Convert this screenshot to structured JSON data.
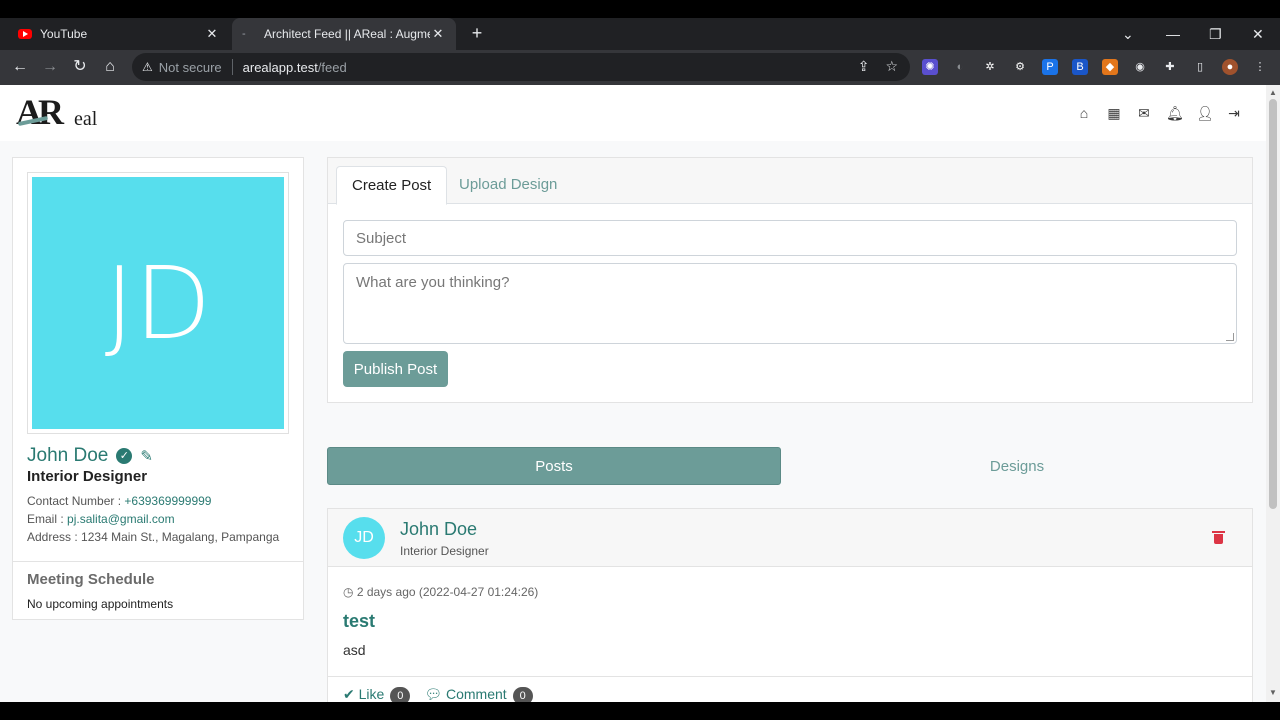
{
  "browser": {
    "tabs": [
      {
        "title": "YouTube",
        "icon": "youtube-icon"
      },
      {
        "title": "Architect Feed || AReal : Augmen",
        "icon": "loading-icon"
      }
    ],
    "omnibox": {
      "security": "Not secure",
      "host": "arealapp.test",
      "path": "/feed"
    }
  },
  "logo": {
    "letters_main": "AR",
    "letters_tail": "eal"
  },
  "nav_icons": [
    "home-icon",
    "calendar-icon",
    "envelope-icon",
    "bell-icon",
    "user-icon",
    "sign-out-icon"
  ],
  "profile": {
    "initials": "JD",
    "name": "John Doe",
    "role": "Interior Designer",
    "contact_label": "Contact Number :",
    "contact_value": "+639369999999",
    "email_label": "Email :",
    "email_value": "pj.salita@gmail.com",
    "address_label": "Address :",
    "address_value": "1234 Main St., Magalang, Pampanga",
    "avatar_color": "#57deed"
  },
  "meetings": {
    "title": "Meeting Schedule",
    "empty": "No upcoming appointments"
  },
  "composer": {
    "tab_create": "Create Post",
    "tab_upload": "Upload Design",
    "subject_placeholder": "Subject",
    "body_placeholder": "What are you thinking?",
    "publish": "Publish Post"
  },
  "feed_tabs": {
    "posts": "Posts",
    "designs": "Designs"
  },
  "post": {
    "initials": "JD",
    "author": "John Doe",
    "role": "Interior Designer",
    "time": "2 days ago (2022-04-27 01:24:26)",
    "title": "test",
    "body": "asd",
    "like_label": "Like",
    "like_count": "0",
    "comment_label": "Comment",
    "comment_count": "0"
  },
  "colors": {
    "accent": "#6c9c98",
    "accent_dark": "#2a7a72",
    "danger": "#dc3545"
  }
}
